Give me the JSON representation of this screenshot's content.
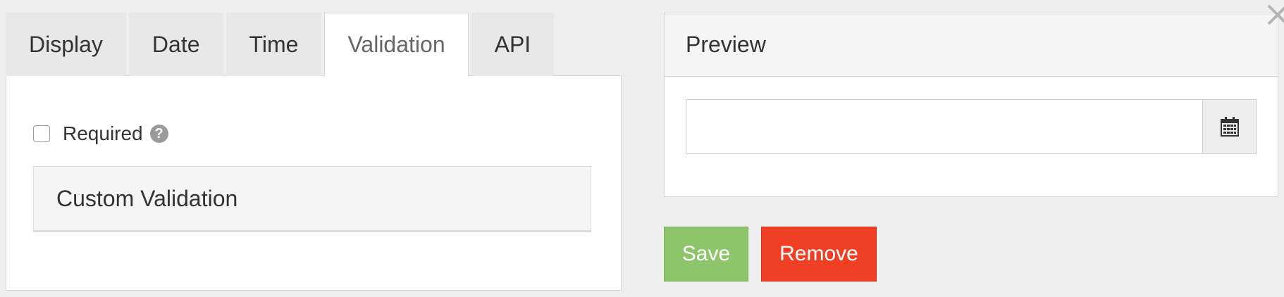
{
  "tabs": [
    {
      "label": "Display",
      "active": false
    },
    {
      "label": "Date",
      "active": false
    },
    {
      "label": "Time",
      "active": false
    },
    {
      "label": "Validation",
      "active": true
    },
    {
      "label": "API",
      "active": false
    }
  ],
  "validation": {
    "required_label": "Required",
    "required_checked": false,
    "help_icon": "question-circle-icon",
    "custom_validation_label": "Custom Validation"
  },
  "preview": {
    "title": "Preview",
    "input_value": "",
    "calendar_icon": "calendar-icon"
  },
  "actions": {
    "save_label": "Save",
    "remove_label": "Remove"
  },
  "colors": {
    "save": "#8cc56a",
    "remove": "#ef3f25",
    "background": "#efefef"
  },
  "close_icon": "close-icon"
}
